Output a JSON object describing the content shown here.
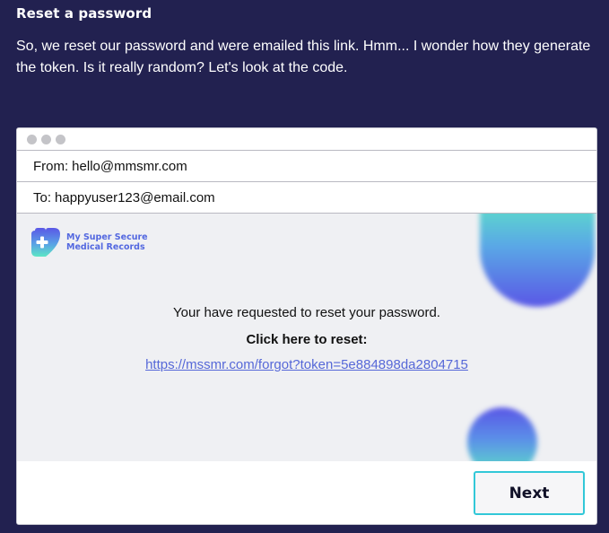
{
  "page": {
    "title": "Reset a password",
    "intro": "So, we reset our password and were emailed this link. Hmm... I wonder how they generate the token. Is it really random? Let's look at the code."
  },
  "email": {
    "from_label": "From:",
    "from_value": "hello@mmsmr.com",
    "to_label": "To:",
    "to_value": "happyuser123@email.com",
    "logo": {
      "icon": "heart-plus-icon",
      "line1": "My Super Secure",
      "line2": "Medical Records"
    },
    "message": "Your have requested to reset your password.",
    "cta": "Click here to reset:",
    "link": "https://mssmr.com/forgot?token=5e884898da2804715"
  },
  "footer": {
    "next_label": "Next"
  },
  "colors": {
    "background": "#222150",
    "accent": "#32c8d8",
    "link": "#5668d8",
    "brand": "#5368e0"
  }
}
